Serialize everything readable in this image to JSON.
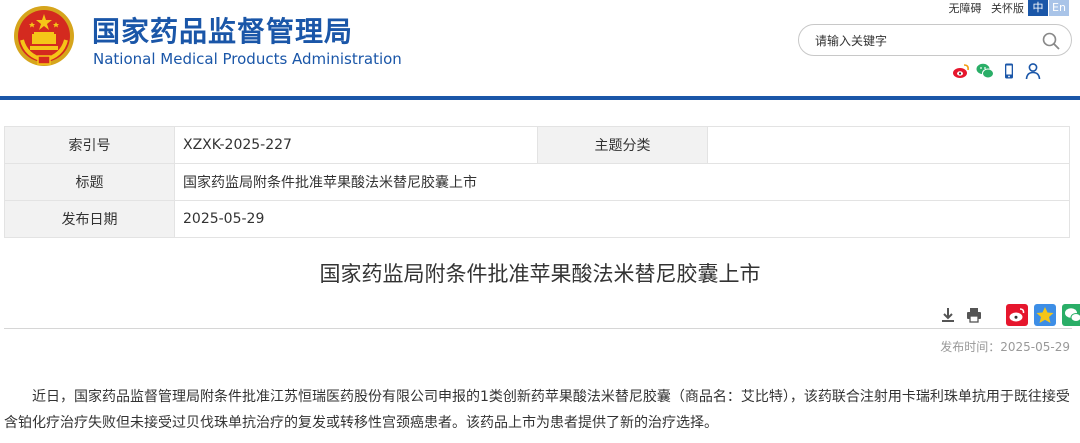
{
  "header": {
    "title_cn": "国家药品监督管理局",
    "title_en": "National Medical Products Administration",
    "accessibility_link": "无障碍",
    "elderly_link": "关怀版",
    "lang_zh": "中",
    "lang_en": "En",
    "search_placeholder": "请输入关键字",
    "social_icons": [
      "weibo-icon",
      "wechat-icon",
      "mobile-icon",
      "user-icon"
    ],
    "accent_color": "#1a56a8"
  },
  "info": {
    "index_label": "索引号",
    "index_value": "XZXK-2025-227",
    "category_label": "主题分类",
    "category_value": "",
    "title_label": "标题",
    "title_value": "国家药监局附条件批准苹果酸法米替尼胶囊上市",
    "date_label": "发布日期",
    "date_value": "2025-05-29"
  },
  "article": {
    "title": "国家药监局附条件批准苹果酸法米替尼胶囊上市",
    "pub_date": "发布时间：2025-05-29",
    "tool_icons": [
      "download-icon",
      "print-icon",
      "weibo-share-icon",
      "qzone-share-icon",
      "wechat-share-icon"
    ],
    "body": "近日，国家药品监督管理局附条件批准江苏恒瑞医药股份有限公司申报的1类创新药苹果酸法米替尼胶囊（商品名：艾比特），该药联合注射用卡瑞利珠单抗用于既往接受含铂化疗治疗失败但未接受过贝伐珠单抗治疗的复发或转移性宫颈癌患者。该药品上市为患者提供了新的治疗选择。"
  }
}
